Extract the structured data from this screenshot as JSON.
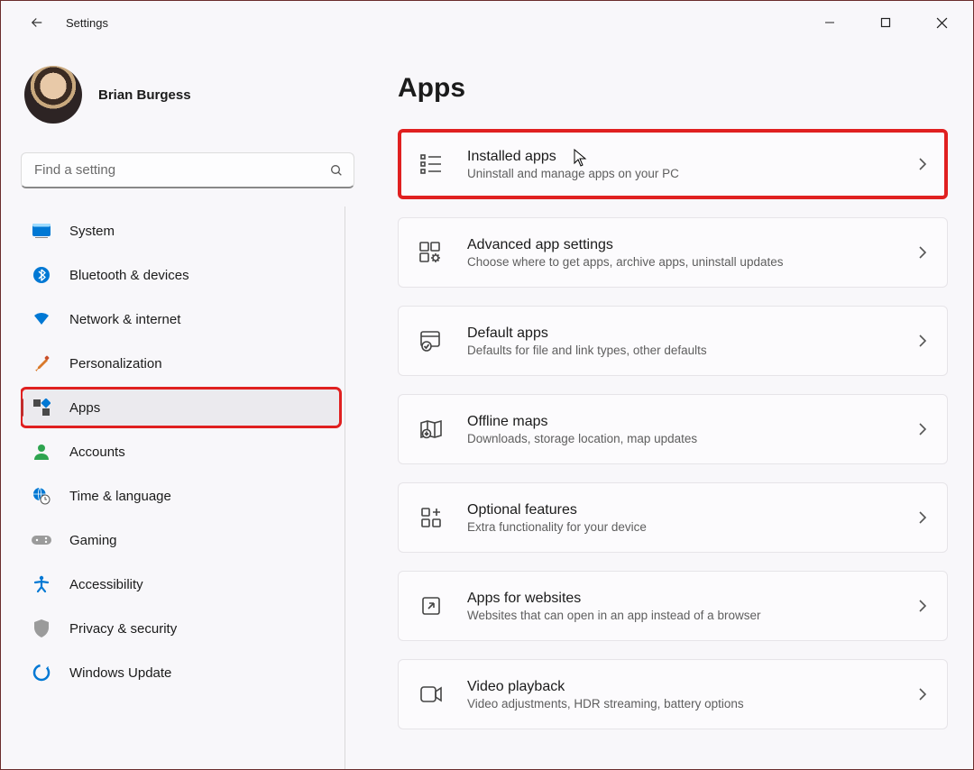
{
  "window": {
    "title": "Settings"
  },
  "profile": {
    "name": "Brian Burgess"
  },
  "search": {
    "placeholder": "Find a setting"
  },
  "nav": {
    "items": [
      {
        "label": "System"
      },
      {
        "label": "Bluetooth & devices"
      },
      {
        "label": "Network & internet"
      },
      {
        "label": "Personalization"
      },
      {
        "label": "Apps"
      },
      {
        "label": "Accounts"
      },
      {
        "label": "Time & language"
      },
      {
        "label": "Gaming"
      },
      {
        "label": "Accessibility"
      },
      {
        "label": "Privacy & security"
      },
      {
        "label": "Windows Update"
      }
    ],
    "selected_index": 4
  },
  "page": {
    "title": "Apps",
    "cards": [
      {
        "title": "Installed apps",
        "subtitle": "Uninstall and manage apps on your PC"
      },
      {
        "title": "Advanced app settings",
        "subtitle": "Choose where to get apps, archive apps, uninstall updates"
      },
      {
        "title": "Default apps",
        "subtitle": "Defaults for file and link types, other defaults"
      },
      {
        "title": "Offline maps",
        "subtitle": "Downloads, storage location, map updates"
      },
      {
        "title": "Optional features",
        "subtitle": "Extra functionality for your device"
      },
      {
        "title": "Apps for websites",
        "subtitle": "Websites that can open in an app instead of a browser"
      },
      {
        "title": "Video playback",
        "subtitle": "Video adjustments, HDR streaming, battery options"
      }
    ],
    "highlighted_card_index": 0
  }
}
